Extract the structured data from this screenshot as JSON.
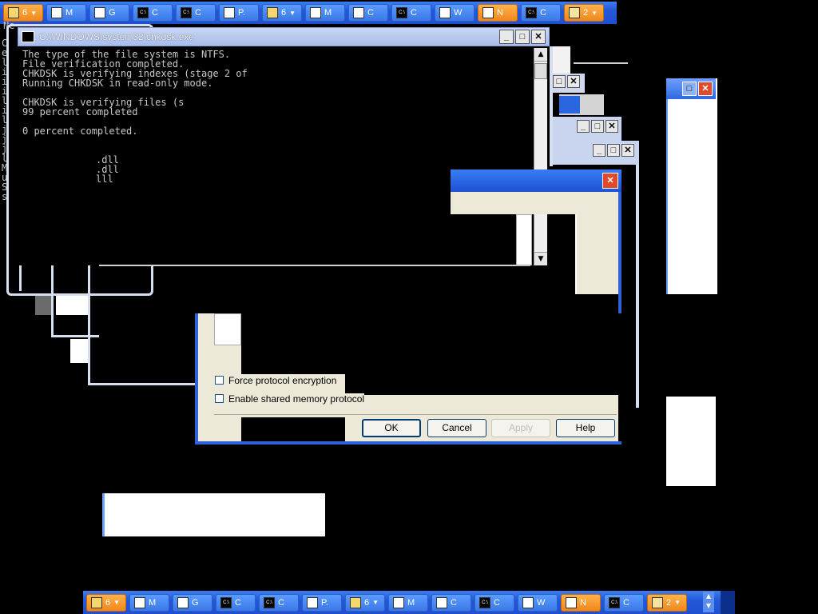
{
  "top_taskbar": {
    "buttons": [
      {
        "label": "6",
        "icon": "folder-icon",
        "style": "orange",
        "caret": true
      },
      {
        "label": "M",
        "icon": "network-icon"
      },
      {
        "label": "G",
        "icon": "app-icon"
      },
      {
        "label": "C",
        "icon": "cmd-icon"
      },
      {
        "label": "C",
        "icon": "cmd-icon"
      },
      {
        "label": "P.",
        "icon": "paint-icon"
      },
      {
        "label": "6",
        "icon": "folder-icon",
        "caret": true
      },
      {
        "label": "M",
        "icon": "network-icon"
      },
      {
        "label": "C",
        "icon": "window-icon"
      },
      {
        "label": "C",
        "icon": "cmd-icon"
      },
      {
        "label": "W",
        "icon": "network-icon"
      },
      {
        "label": "N",
        "icon": "network-icon",
        "style": "orange"
      },
      {
        "label": "C",
        "icon": "cmd-icon"
      },
      {
        "label": "2",
        "icon": "tools-icon",
        "style": "orange",
        "caret": true
      }
    ]
  },
  "bottom_taskbar": {
    "buttons": [
      {
        "label": "6",
        "icon": "folder-icon",
        "style": "orange",
        "caret": true
      },
      {
        "label": "M",
        "icon": "network-icon"
      },
      {
        "label": "G",
        "icon": "app-icon"
      },
      {
        "label": "C",
        "icon": "cmd-icon"
      },
      {
        "label": "C",
        "icon": "cmd-icon"
      },
      {
        "label": "P.",
        "icon": "paint-icon"
      },
      {
        "label": "6",
        "icon": "folder-icon",
        "caret": true
      },
      {
        "label": "M",
        "icon": "network-icon"
      },
      {
        "label": "C",
        "icon": "window-icon"
      },
      {
        "label": "C",
        "icon": "cmd-icon"
      },
      {
        "label": "W",
        "icon": "network-icon"
      },
      {
        "label": "N",
        "icon": "network-icon",
        "style": "orange"
      },
      {
        "label": "C",
        "icon": "cmd-icon"
      },
      {
        "label": "2",
        "icon": "tools-icon",
        "style": "orange",
        "caret": true
      }
    ]
  },
  "chkdsk_window": {
    "title": "C:\\WINDOWS\\system32\\chkdsk.exe",
    "lines": [
      "The type of the file system is NTFS.",
      "File verification completed.",
      "CHKDSK is verifying indexes (stage 2 of",
      "Running CHKDSK in read-only mode.",
      "",
      "CHKDSK is verifying files (s",
      "99 percent completed",
      "",
      "0 percent completed.",
      "",
      "",
      ".dll",
      ".dll",
      "lll"
    ]
  },
  "background_console": {
    "top_text": "Ne",
    "left_column": [
      "C",
      "e",
      "l",
      "i",
      "i",
      "i",
      "l",
      "i",
      "l",
      "j",
      "j",
      "j",
      "l",
      "M",
      "u",
      "S",
      "s"
    ]
  },
  "dialog": {
    "options": [
      {
        "label": "Force protocol encryption",
        "checked": false
      },
      {
        "label": "Enable shared memory protocol",
        "checked": false
      }
    ],
    "buttons": {
      "ok": "OK",
      "cancel": "Cancel",
      "apply": "Apply",
      "help": "Help"
    }
  },
  "colors": {
    "xp_blue": "#2e62d6",
    "taskbar_orange": "#f0881c",
    "close_red": "#e0492a",
    "dialog_face": "#ece9d8"
  }
}
